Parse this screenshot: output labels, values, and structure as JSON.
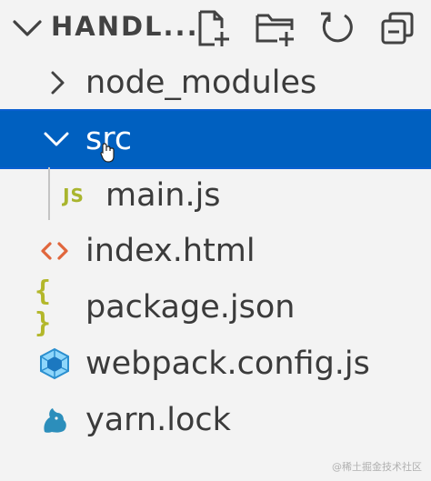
{
  "header": {
    "title": "HANDL...",
    "actions": [
      {
        "name": "new-file-icon"
      },
      {
        "name": "new-folder-icon"
      },
      {
        "name": "refresh-icon"
      },
      {
        "name": "collapse-all-icon"
      }
    ]
  },
  "tree": [
    {
      "label": "node_modules",
      "type": "folder",
      "expanded": false,
      "icon": "chevron-right-icon"
    },
    {
      "label": "src",
      "type": "folder",
      "expanded": true,
      "selected": true,
      "icon": "chevron-down-icon"
    },
    {
      "label": "main.js",
      "type": "file",
      "icon": "javascript-file-icon",
      "badge": "JS",
      "badge_color": "#a9b52e"
    },
    {
      "label": "index.html",
      "type": "file",
      "icon": "html-file-icon",
      "badge_color": "#e0663c"
    },
    {
      "label": "package.json",
      "type": "file",
      "icon": "json-file-icon",
      "badge": "{ }",
      "badge_color": "#b3b72a"
    },
    {
      "label": "webpack.config.js",
      "type": "file",
      "icon": "webpack-icon",
      "badge_color": "#2b8fcf"
    },
    {
      "label": "yarn.lock",
      "type": "file",
      "icon": "yarn-icon",
      "badge_color": "#2c8ebb"
    }
  ],
  "colors": {
    "background": "#f3f3f3",
    "selection": "#0060c0",
    "text": "#3b3b3b"
  },
  "watermark": "@稀土掘金技术社区"
}
